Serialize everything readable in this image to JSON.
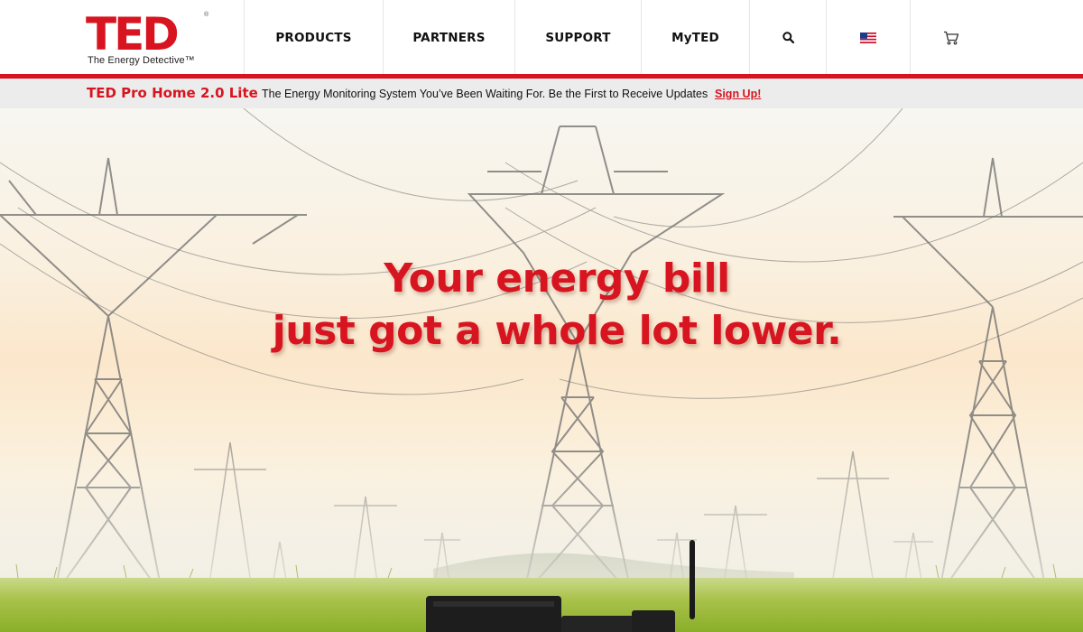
{
  "logo": {
    "wordmark": "TED",
    "tagline": "The Energy Detective™",
    "brand_color": "#d7141f"
  },
  "nav": {
    "items": [
      {
        "label": "PRODUCTS"
      },
      {
        "label": "PARTNERS"
      },
      {
        "label": "SUPPORT"
      },
      {
        "label": "MyTED"
      }
    ],
    "search_icon": "search-icon",
    "flag_icon": "us-flag-icon",
    "cart_icon": "cart-icon"
  },
  "promo_bar": {
    "title": "TED Pro Home 2.0 Lite",
    "message": "The Energy Monitoring System You’ve Been Waiting For. Be the First to Receive Updates",
    "link_label": "Sign Up!"
  },
  "hero": {
    "headline_line1": "Your energy bill",
    "headline_line2": "just got a whole lot lower."
  },
  "colors": {
    "accent": "#d7141f",
    "promo_background": "#ececec",
    "nav_text": "#111111"
  }
}
